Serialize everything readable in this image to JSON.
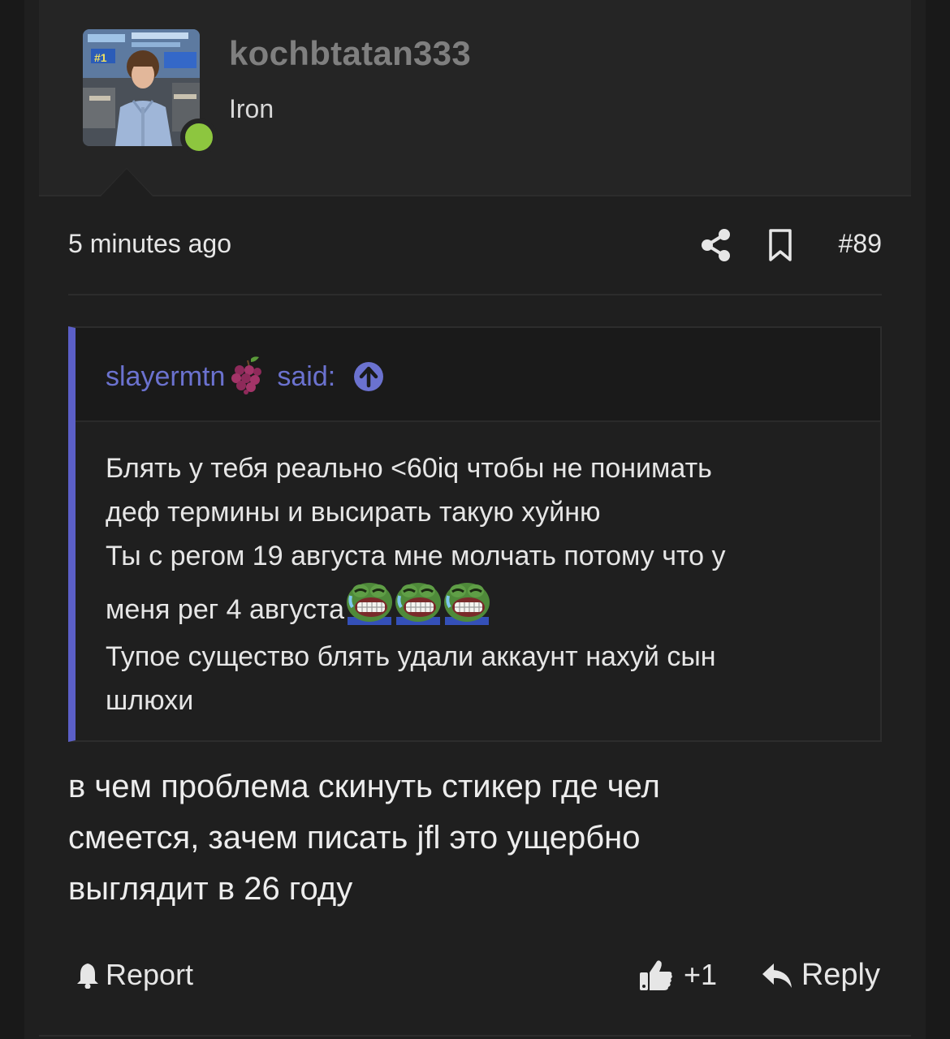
{
  "user": {
    "username": "kochbtatan333",
    "title": "Iron",
    "online_color": "#8dc63f"
  },
  "post_meta": {
    "timestamp": "5 minutes ago",
    "share_icon": "share-icon",
    "bookmark_icon": "bookmark-icon",
    "post_number": "#89"
  },
  "quote": {
    "author": "slayermtn",
    "author_emoji": "grapes-icon",
    "said_label": "said:",
    "jump_icon": "arrow-up-circle-icon",
    "accent_color": "#5b5fc7",
    "lines": [
      "Блять у тебя реально <60iq чтобы не понимать",
      "деф термины и высирать такую хуйню",
      "Ты с регом 19 августа мне молчать потому что у",
      "меня рег 4 августа",
      "Тупое существо блять удали аккаунт нахуй сын",
      "шлюхи"
    ],
    "emoji_after_line_4": [
      "pepe-laugh-icon",
      "pepe-laugh-icon",
      "pepe-laugh-icon"
    ]
  },
  "message": {
    "lines": [
      "в чем проблема скинуть стикер где чел",
      "смеется, зачем писать jfl это ущербно",
      "выглядит в 26 году"
    ]
  },
  "actions": {
    "report_label": "Report",
    "like_count": "+1",
    "reply_label": "Reply"
  }
}
